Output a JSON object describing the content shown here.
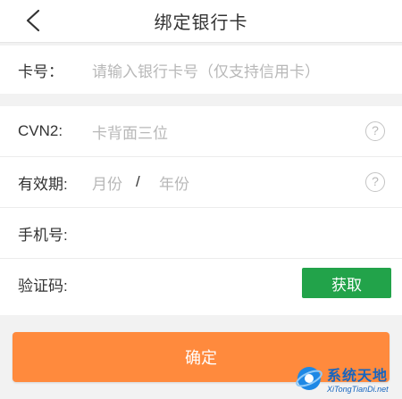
{
  "header": {
    "title": "绑定银行卡"
  },
  "card_number": {
    "label": "卡号：",
    "placeholder": "请输入银行卡号（仅支持信用卡）"
  },
  "cvn2": {
    "label": "CVN2:",
    "placeholder": "卡背面三位",
    "help": "?"
  },
  "expiry": {
    "label": "有效期:",
    "month_placeholder": "月份",
    "separator": "/",
    "year_placeholder": "年份",
    "help": "?"
  },
  "phone": {
    "label": "手机号:"
  },
  "verification": {
    "label": "验证码:",
    "button": "获取"
  },
  "confirm": {
    "label": "确定"
  },
  "watermark": {
    "title": "系统天地",
    "url": "XiTongTianDi.net"
  },
  "colors": {
    "accent_orange": "#ff8a3d",
    "accent_green": "#22a34a",
    "placeholder_gray": "#b8b8b8"
  }
}
